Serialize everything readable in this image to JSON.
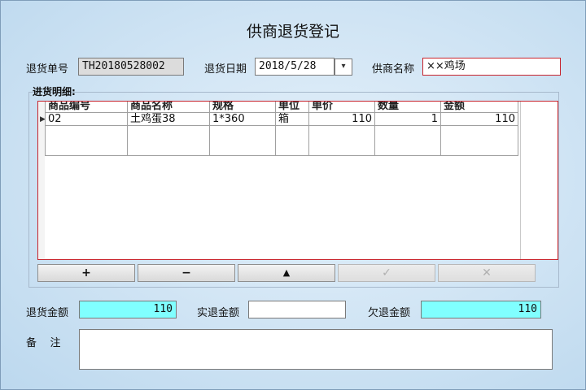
{
  "title": "供商退货登记",
  "header": {
    "return_no_label": "退货单号",
    "return_no": "TH20180528002",
    "return_date_label": "退货日期",
    "return_date": "2018/5/28",
    "supplier_label": "供商名称",
    "supplier": "××鸡场"
  },
  "details": {
    "group_label": "进货明细:",
    "columns": [
      "商品编号",
      "商品名称",
      "规格",
      "单位",
      "单价",
      "数量",
      "金额"
    ],
    "rows": [
      {
        "code": "02",
        "name": "土鸡蛋38",
        "spec": "1*360",
        "unit": "箱",
        "price": "110",
        "qty": "1",
        "amount": "110"
      }
    ],
    "buttons": [
      "+",
      "−",
      "▲",
      "✓",
      "✕"
    ]
  },
  "totals": {
    "return_amount_label": "退货金额",
    "return_amount": "110",
    "actual_refund_label": "实退金额",
    "actual_refund": "",
    "owed_refund_label": "欠退金额",
    "owed_refund": "110"
  },
  "remark": {
    "label": "备    注",
    "value": ""
  }
}
